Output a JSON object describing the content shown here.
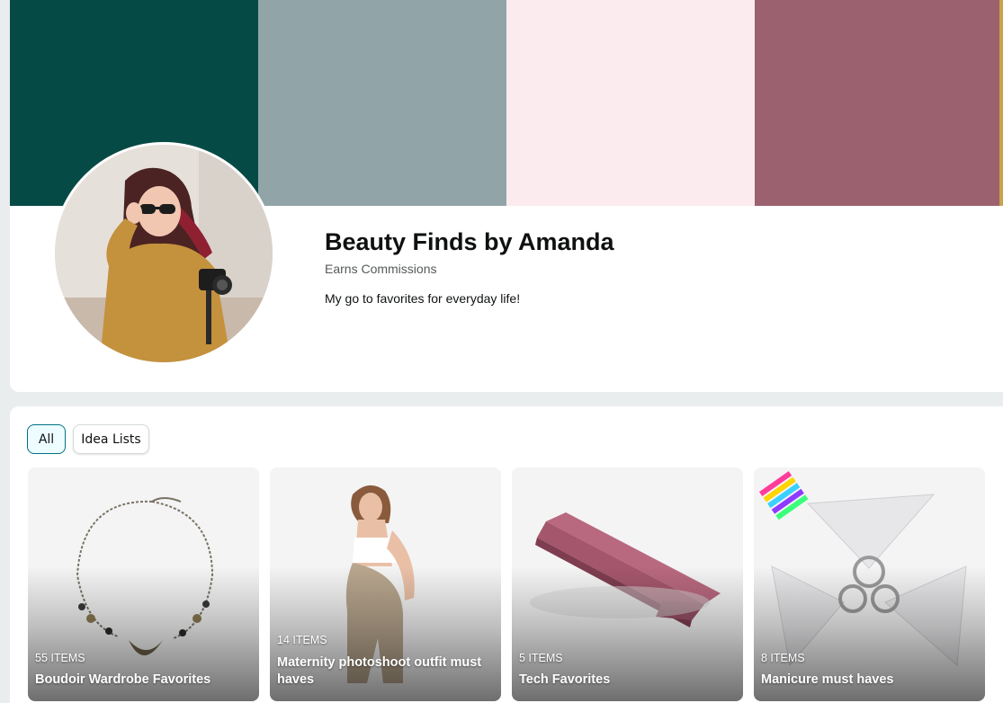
{
  "banner": {
    "colors": [
      "#064a45",
      "#91a5a8",
      "#fbebee",
      "#9b616e"
    ]
  },
  "profile": {
    "name": "Beauty Finds by Amanda",
    "badge": "Earns Commissions",
    "bio": "My go to favorites for everyday life!",
    "avatar": "profile-photo"
  },
  "filters": {
    "all_label": "All",
    "idea_label": "Idea Lists",
    "selected": "All"
  },
  "lists": [
    {
      "count": "55 ITEMS",
      "title": "Boudoir Wardrobe Favorites",
      "image": "necklace"
    },
    {
      "count": "14 ITEMS",
      "title": "Maternity photoshoot outfit must haves",
      "image": "maternity-shapewear"
    },
    {
      "count": "5 ITEMS",
      "title": "Tech Favorites",
      "image": "pink-external-ssd"
    },
    {
      "count": "8 ITEMS",
      "title": "Manicure must haves",
      "image": "nail-swatch-fans"
    }
  ]
}
